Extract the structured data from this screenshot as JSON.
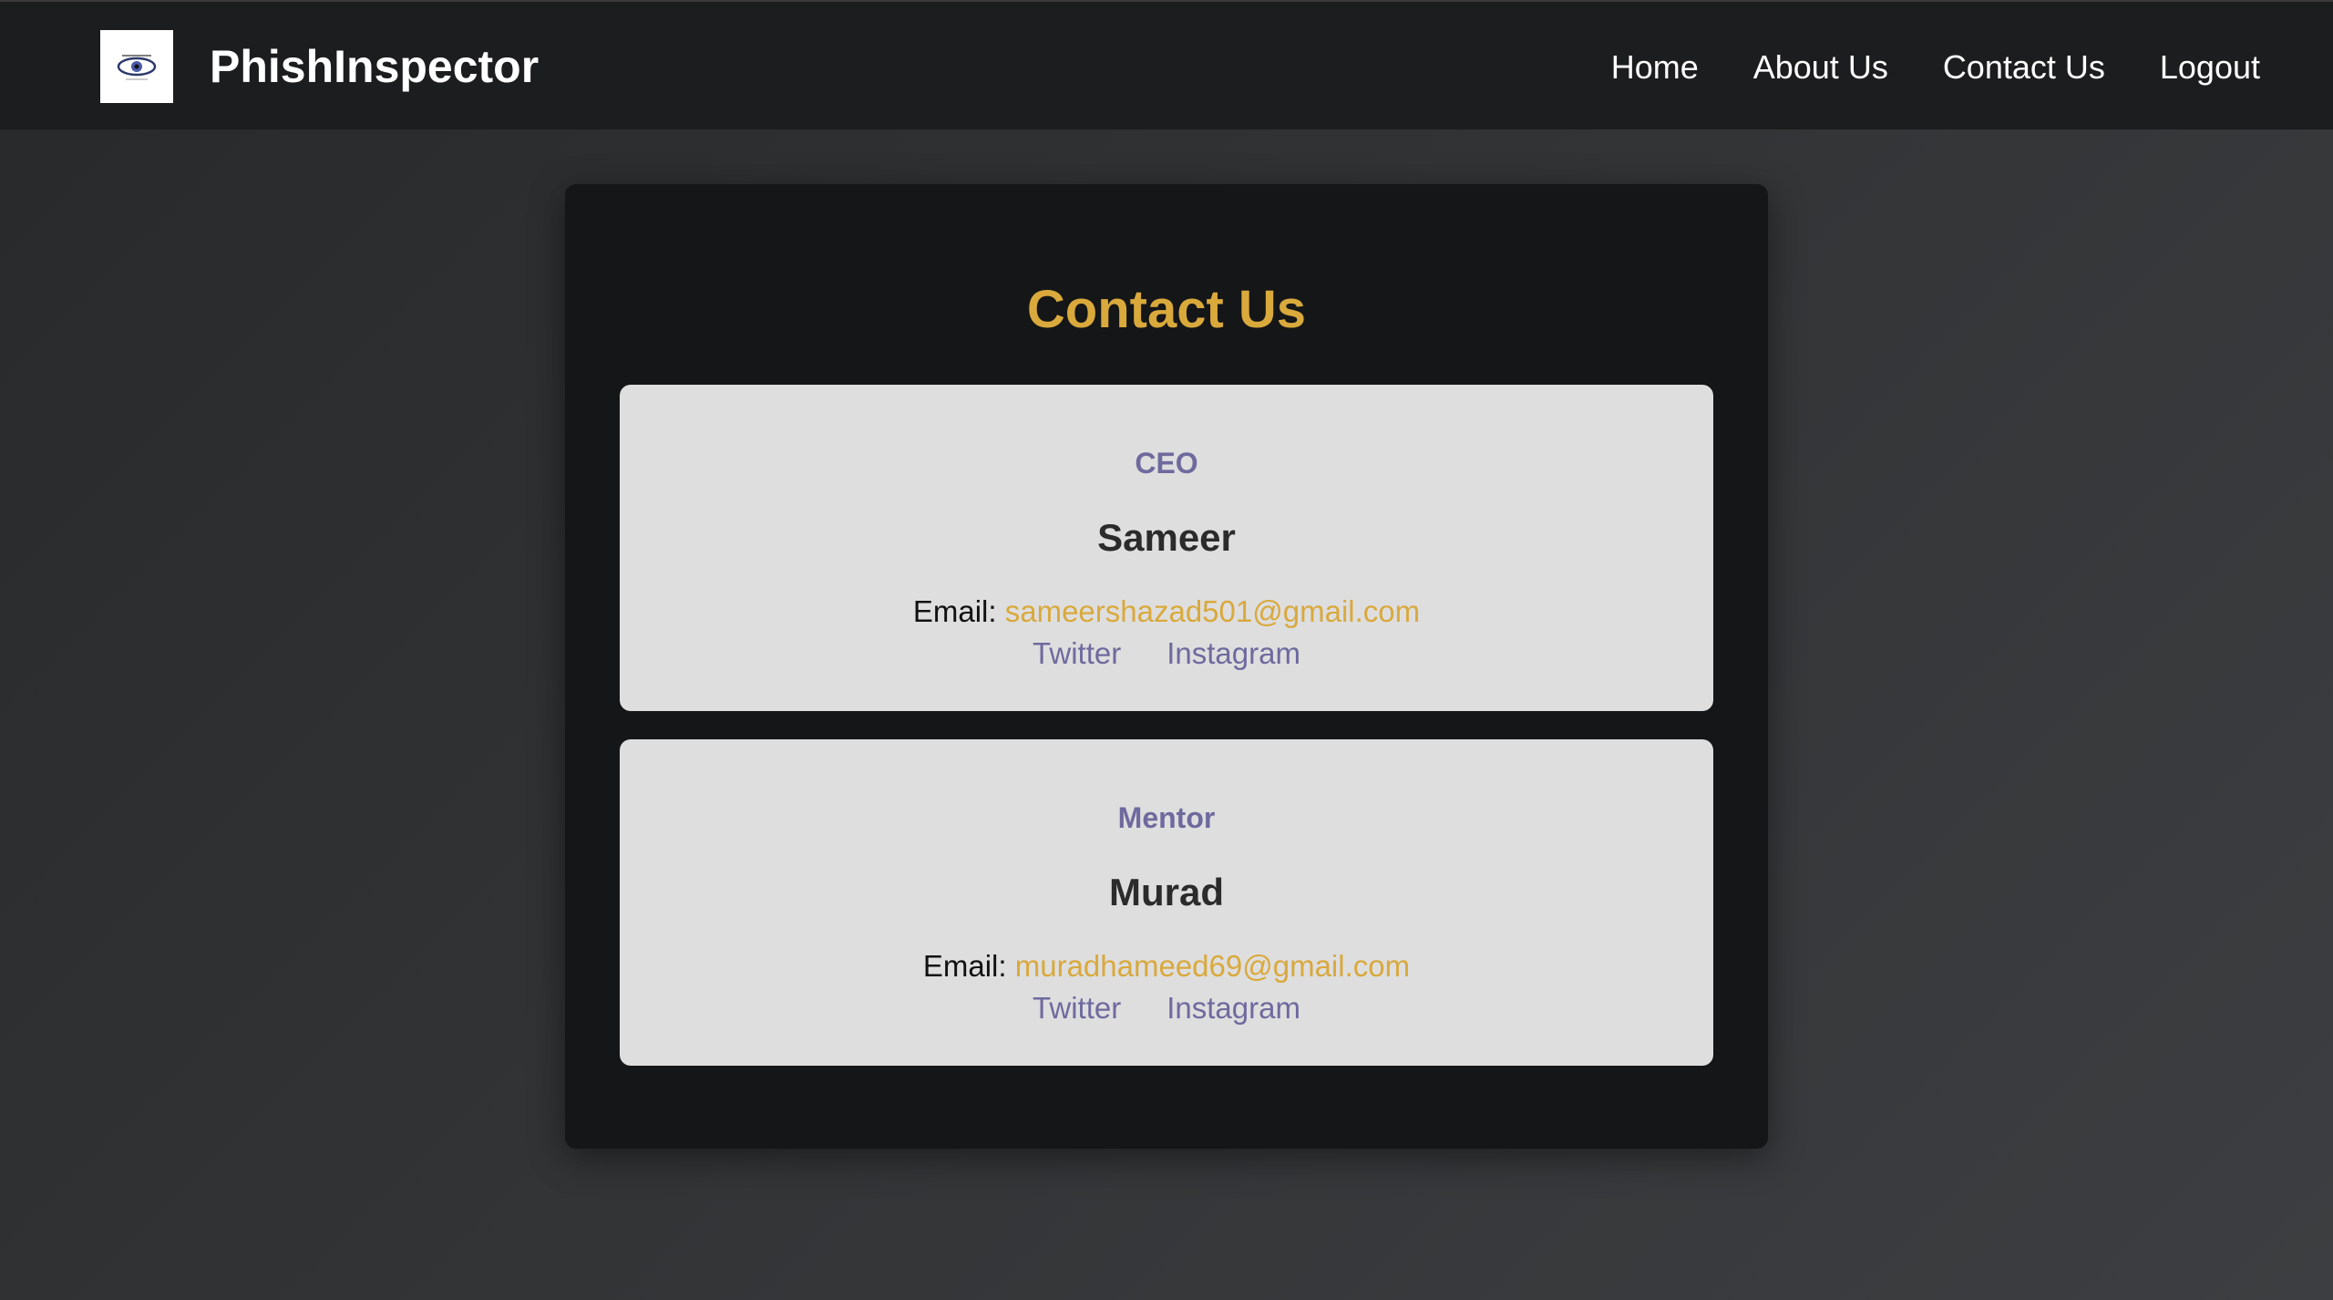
{
  "header": {
    "brand": "PhishInspector",
    "logo_icon": "eye-logo-icon",
    "nav": [
      {
        "label": "Home"
      },
      {
        "label": "About Us"
      },
      {
        "label": "Contact Us"
      },
      {
        "label": "Logout"
      }
    ]
  },
  "main": {
    "title": "Contact Us",
    "email_prefix": "Email:",
    "contacts": [
      {
        "role": "CEO",
        "name": "Sameer",
        "email": "sameershazad501@gmail.com",
        "twitter_label": "Twitter",
        "instagram_label": "Instagram"
      },
      {
        "role": "Mentor",
        "name": "Murad",
        "email": "muradhameed69@gmail.com",
        "twitter_label": "Twitter",
        "instagram_label": "Instagram"
      }
    ]
  },
  "colors": {
    "accent": "#d9a93c",
    "link": "#6e6a9e",
    "card_bg": "#dedede",
    "panel_bg": "#151617",
    "header_bg": "#1c1d1e"
  }
}
